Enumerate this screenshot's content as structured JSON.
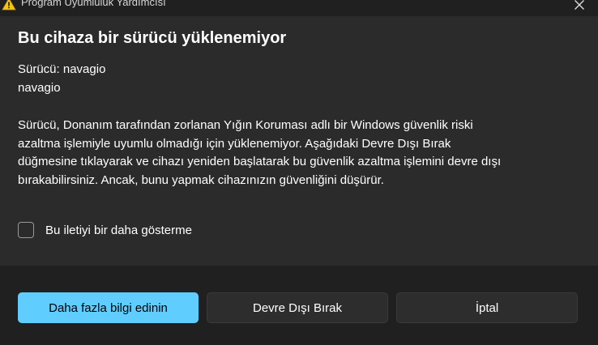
{
  "window": {
    "title": "Program Uyumluluk Yardımcısı",
    "title_icon": "warning-icon",
    "close_icon": "close-icon"
  },
  "dialog": {
    "heading": "Bu cihaza bir sürücü yüklenemiyor",
    "driver_label": "Sürücü: navagio",
    "driver_name": "navagio",
    "body_lines": [
      "Sürücü, Donanım tarafından zorlanan Yığın Koruması adlı bir Windows güvenlik riski",
      "azaltma işlemiyle uyumlu olmadığı için yüklenemiyor. Aşağıdaki Devre Dışı Bırak",
      "düğmesine tıklayarak ve cihazı yeniden başlatarak bu güvenlik azaltma işlemini devre dışı",
      "bırakabilirsiniz. Ancak, bunu yapmak cihazınızın güvenliğini düşürür."
    ],
    "checkbox_label": "Bu iletiyi bir daha gösterme",
    "checkbox_checked": false
  },
  "buttons": {
    "more_info": "Daha fazla bilgi edinin",
    "disable": "Devre Dışı Bırak",
    "cancel": "İptal"
  },
  "colors": {
    "accent": "#60cdff",
    "warning": "#f5c518"
  }
}
